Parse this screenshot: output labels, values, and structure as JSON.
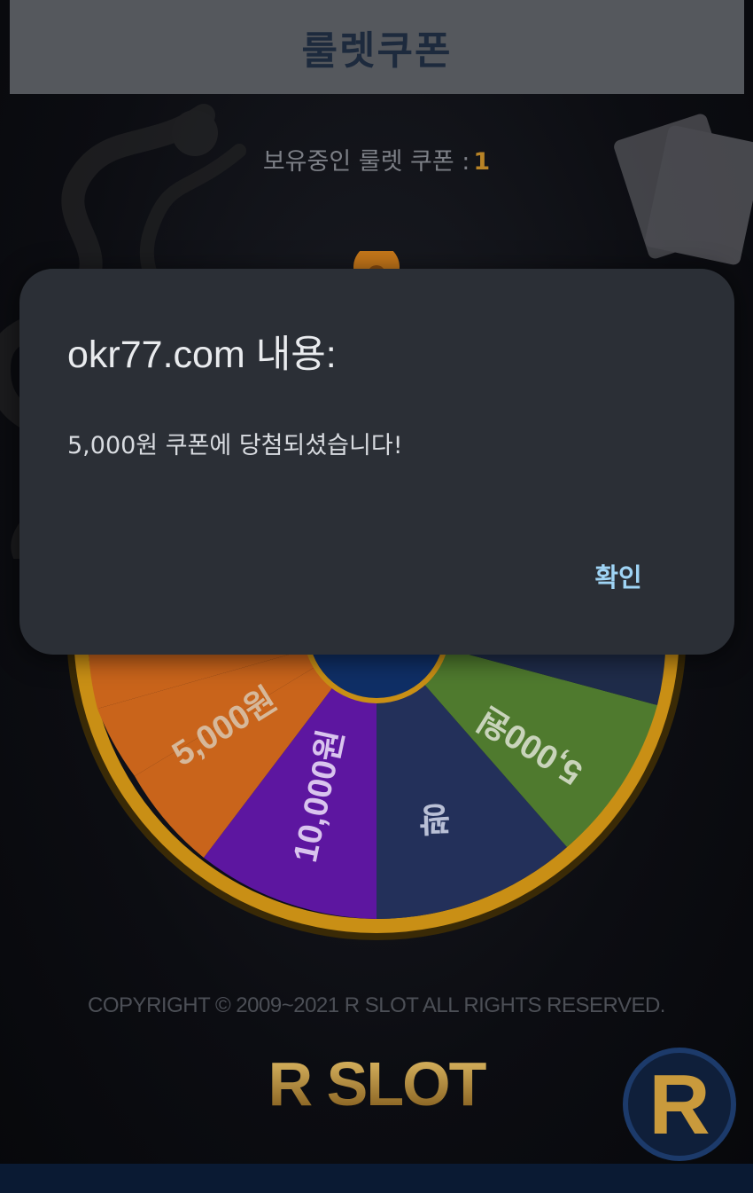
{
  "header": {
    "title": "룰렛쿠폰"
  },
  "coupon": {
    "label": "보유중인 룰렛 쿠폰 :",
    "count": "1"
  },
  "wheel": {
    "segments": [
      {
        "label": "5,000원",
        "color": "#c9641b"
      },
      {
        "label": "10,000원",
        "color": "#5d16a0"
      },
      {
        "label": "꽝",
        "color": "#23305a"
      },
      {
        "label": "5,000원",
        "color": "#4f7a2e"
      }
    ],
    "colors": {
      "rim": "#d69a1a",
      "red": "#a51010",
      "hub": "#0f2f66"
    }
  },
  "footer": {
    "copyright": "COPYRIGHT © 2009~2021 R SLOT ALL RIGHTS RESERVED.",
    "logo": "R SLOT",
    "badge": "R"
  },
  "dialog": {
    "title": "okr77.com 내용:",
    "message": "5,000원 쿠폰에 당첨되셨습니다!",
    "ok_label": "확인"
  }
}
